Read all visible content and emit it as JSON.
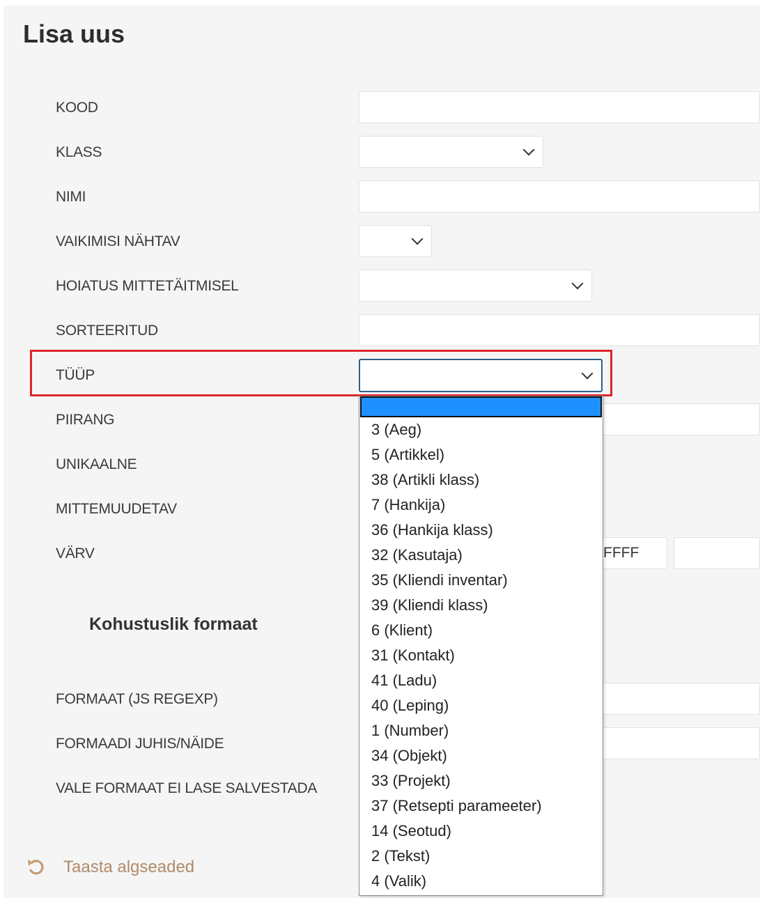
{
  "title": "Lisa uus",
  "form": {
    "kood_label": "KOOD",
    "klass_label": "KLASS",
    "nimi_label": "NIMI",
    "vaikimisi_label": "VAIKIMISI NÄHTAV",
    "hoiatus_label": "HOIATUS MITTETÄITMISEL",
    "sorteeritud_label": "SORTEERITUD",
    "tyyp_label": "TÜÜP",
    "piirang_label": "PIIRANG",
    "unikaalne_label": "UNIKAALNE",
    "mittemuudetav_label": "MITTEMUUDETAV",
    "varv_label": "VÄRV",
    "varv_value": "FFFF"
  },
  "format_section": {
    "heading": "Kohustuslik formaat",
    "formaat_label": "FORMAAT (JS REGEXP)",
    "juhis_label": "FORMAADI JUHIS/NÄIDE",
    "vale_label": "VALE FORMAAT EI LASE SALVESTADA"
  },
  "reset": {
    "label": "Taasta algseaded",
    "icon": "undo-icon"
  },
  "type_dropdown": {
    "selected": "",
    "options": [
      "3 (Aeg)",
      "5 (Artikkel)",
      "38 (Artikli klass)",
      "7 (Hankija)",
      "36 (Hankija klass)",
      "32 (Kasutaja)",
      "35 (Kliendi inventar)",
      "39 (Kliendi klass)",
      "6 (Klient)",
      "31 (Kontakt)",
      "41 (Ladu)",
      "40 (Leping)",
      "1 (Number)",
      "34 (Objekt)",
      "33 (Projekt)",
      "37 (Retsepti parameeter)",
      "14 (Seotud)",
      "2 (Tekst)",
      "4 (Valik)"
    ]
  },
  "colors": {
    "highlight": "#e0242c",
    "selected_option": "#1e90ff",
    "reset_text": "#b08a6a"
  }
}
